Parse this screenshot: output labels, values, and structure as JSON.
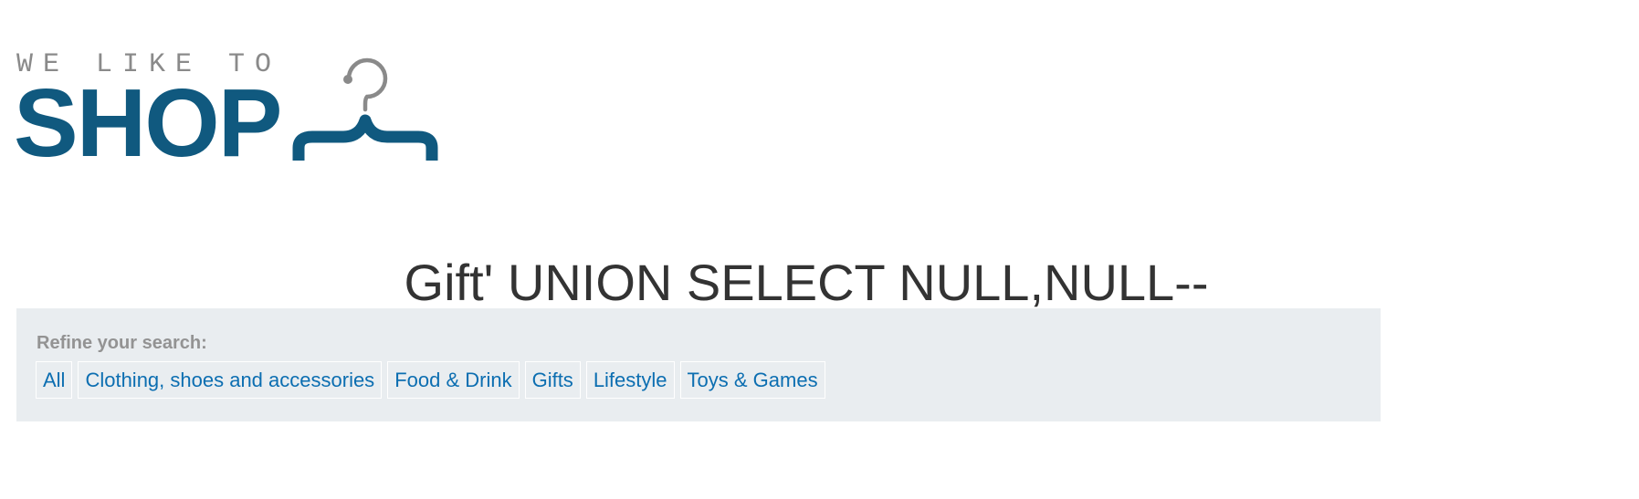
{
  "header": {
    "logo": {
      "tagline": "WE LIKE TO",
      "word": "SHOP",
      "icon": "hanger-icon",
      "colors": {
        "word": "#10597f",
        "tagline": "#8a8a8a",
        "hook": "#8a8a8a"
      }
    }
  },
  "main": {
    "title": "Gift' UNION SELECT NULL,NULL--"
  },
  "filters": {
    "heading": "Refine your search:",
    "categories": [
      {
        "label": "All"
      },
      {
        "label": "Clothing, shoes and accessories"
      },
      {
        "label": "Food & Drink"
      },
      {
        "label": "Gifts"
      },
      {
        "label": "Lifestyle"
      },
      {
        "label": "Toys & Games"
      }
    ],
    "colors": {
      "panel_background": "#e9edf0",
      "link": "#0c6eb1"
    }
  }
}
